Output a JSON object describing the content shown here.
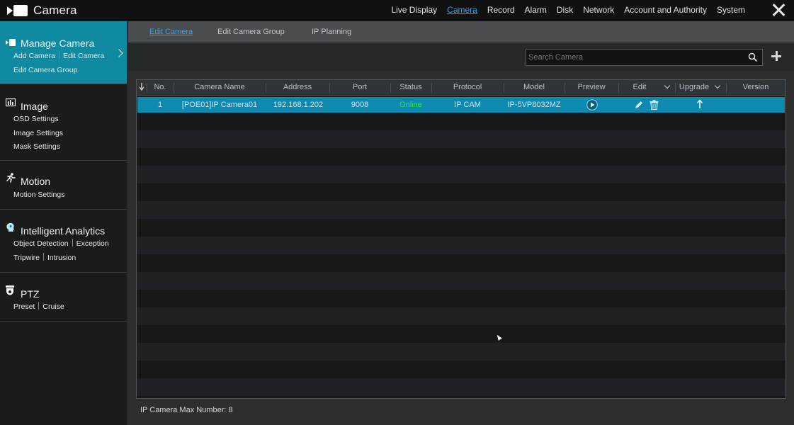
{
  "app": {
    "title": "Camera"
  },
  "topnav": {
    "items": [
      "Live Display",
      "Camera",
      "Record",
      "Alarm",
      "Disk",
      "Network",
      "Account and Authority",
      "System"
    ],
    "active": "Camera"
  },
  "sidebar": {
    "sections": [
      {
        "title": "Manage Camera",
        "active": true,
        "icon": "camera-icon",
        "sub": [
          [
            "Add Camera",
            "Edit Camera"
          ],
          [
            "Edit Camera Group"
          ]
        ]
      },
      {
        "title": "Image",
        "icon": "image-settings-icon",
        "sub": [
          [
            "OSD Settings"
          ],
          [
            "Image Settings"
          ],
          [
            "Mask Settings"
          ]
        ]
      },
      {
        "title": "Motion",
        "icon": "motion-runner-icon",
        "sub": [
          [
            "Motion Settings"
          ]
        ]
      },
      {
        "title": "Intelligent Analytics",
        "icon": "analytics-head-icon",
        "sub": [
          [
            "Object Detection",
            "Exception"
          ],
          [
            "Tripwire",
            "Intrusion"
          ]
        ]
      },
      {
        "title": "PTZ",
        "icon": "ptz-dome-icon",
        "sub": [
          [
            "Preset",
            "Cruise"
          ]
        ]
      }
    ]
  },
  "tabs": {
    "items": [
      "Edit Camera",
      "Edit Camera Group",
      "IP Planning"
    ],
    "active": "Edit Camera"
  },
  "search": {
    "placeholder": "Search Camera"
  },
  "table": {
    "columns": [
      "No.",
      "Camera Name",
      "Address",
      "Port",
      "Status",
      "Protocol",
      "Model",
      "Preview",
      "Edit",
      "Upgrade",
      "Version"
    ],
    "rows": [
      {
        "no": "1",
        "name": "[POE01]IP Camera01",
        "address": "192.168.1.202",
        "port": "9008",
        "status": "Online",
        "protocol": "IP CAM",
        "model": "IP-5VP8032MZ",
        "version": ""
      }
    ]
  },
  "footer": {
    "max_number": "IP Camera Max Number: 8"
  },
  "colors": {
    "accent": "#0e89b0",
    "sidebar_active": "#0f8aa0",
    "online": "#27e43a",
    "link": "#3aa0e0"
  }
}
